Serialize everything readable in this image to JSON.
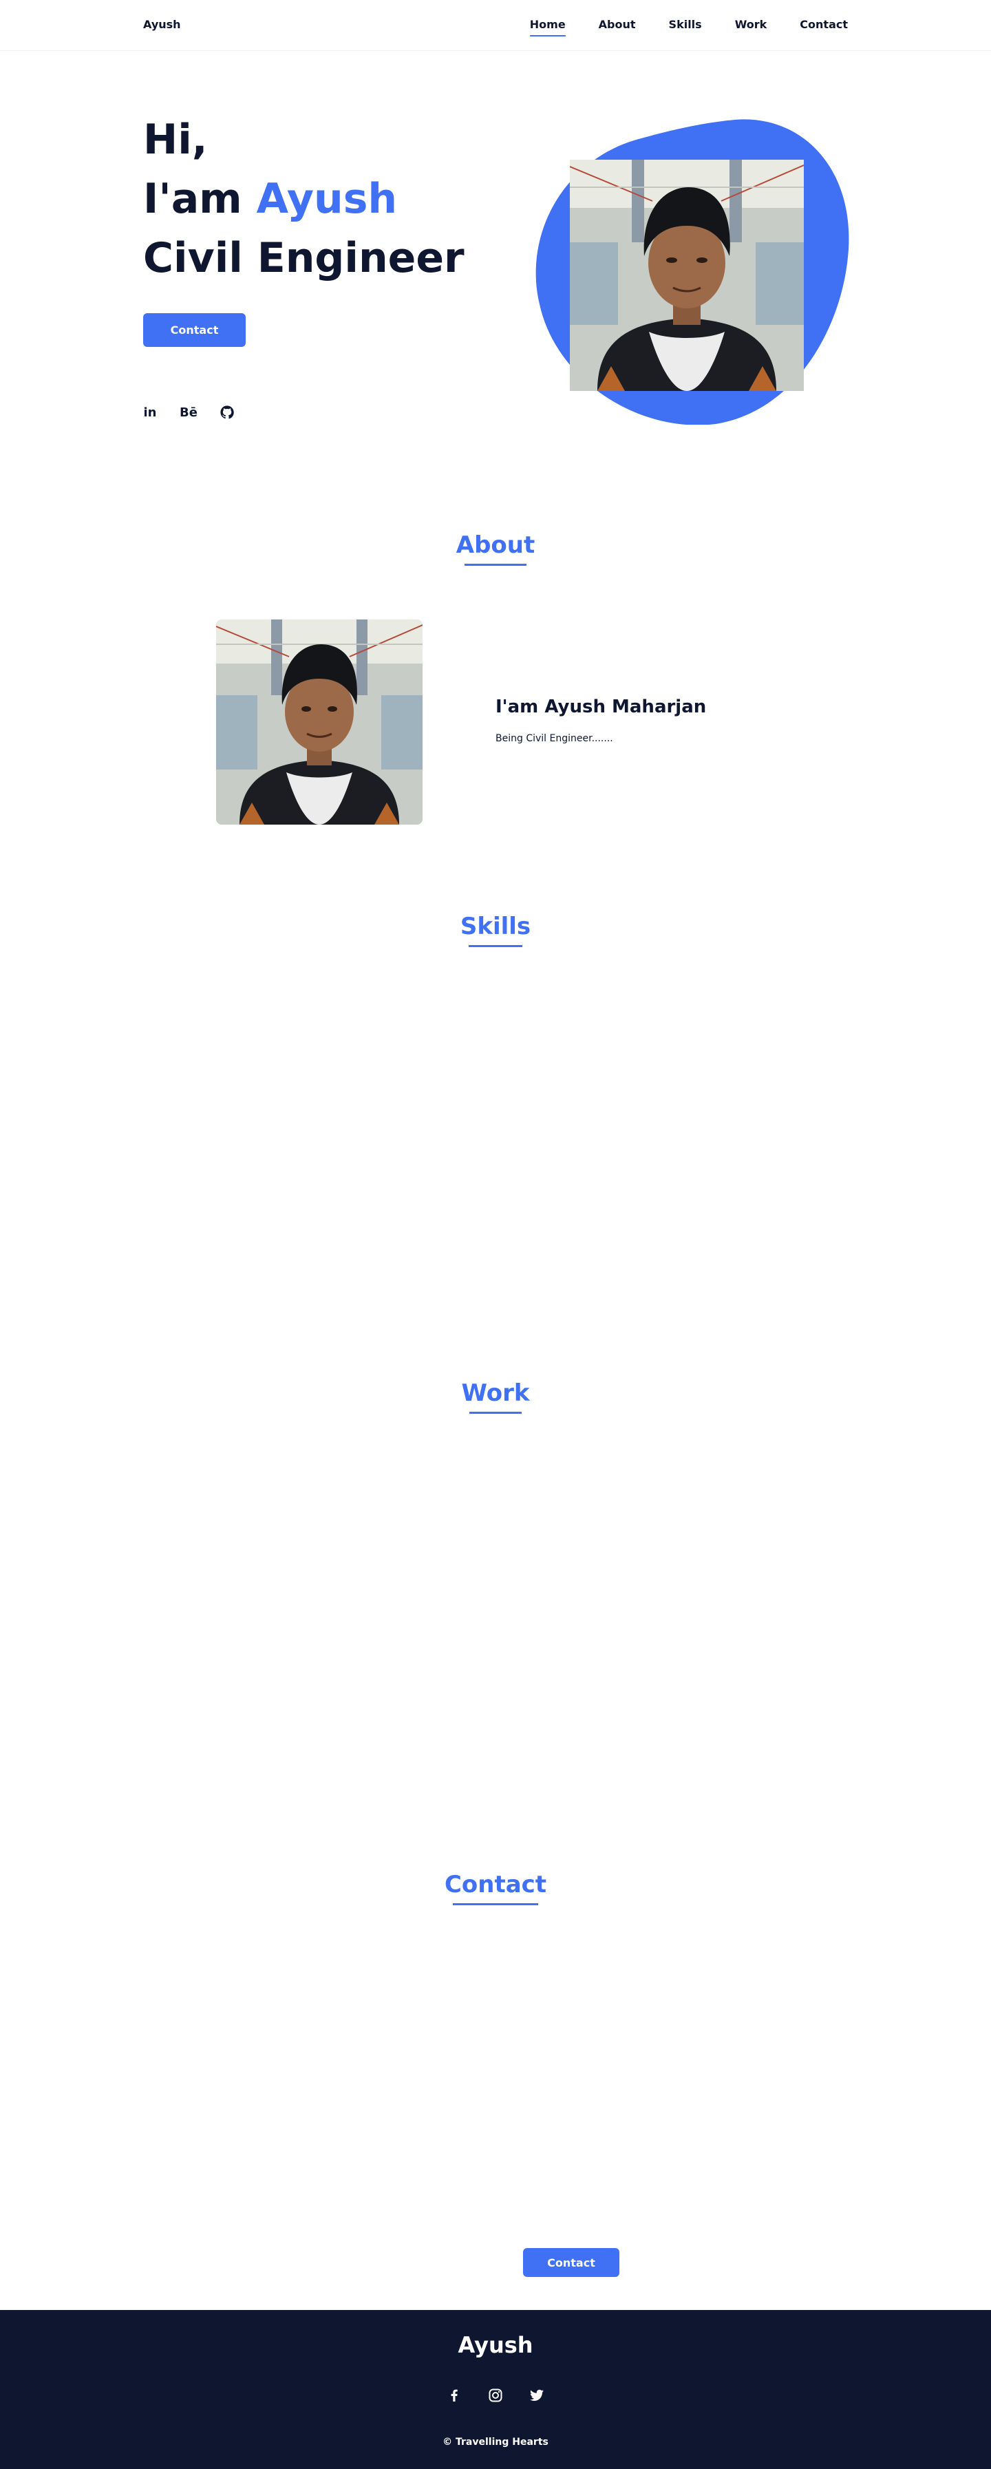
{
  "header": {
    "logo": "Ayush",
    "nav": [
      "Home",
      "About",
      "Skills",
      "Work",
      "Contact"
    ],
    "active": "Home"
  },
  "hero": {
    "greeting": "Hi,",
    "intro_prefix": "I'am ",
    "name": "Ayush",
    "role": "Civil Engineer",
    "button": "Contact",
    "socials": {
      "linkedin": "in",
      "behance": "Bē"
    }
  },
  "about": {
    "title": "About",
    "subtitle": "I'am Ayush Maharjan",
    "text": "Being Civil Engineer......."
  },
  "skills": {
    "title": "Skills"
  },
  "work": {
    "title": "Work"
  },
  "contact": {
    "title": "Contact",
    "button": "Contact"
  },
  "footer": {
    "title": "Ayush",
    "copyright": "© Travelling Hearts"
  },
  "colors": {
    "accent": "#4070f4",
    "dark": "#0e1630",
    "white": "#ffffff"
  },
  "icons": [
    "linkedin-icon",
    "behance-icon",
    "github-icon",
    "facebook-icon",
    "instagram-icon",
    "twitter-icon"
  ]
}
